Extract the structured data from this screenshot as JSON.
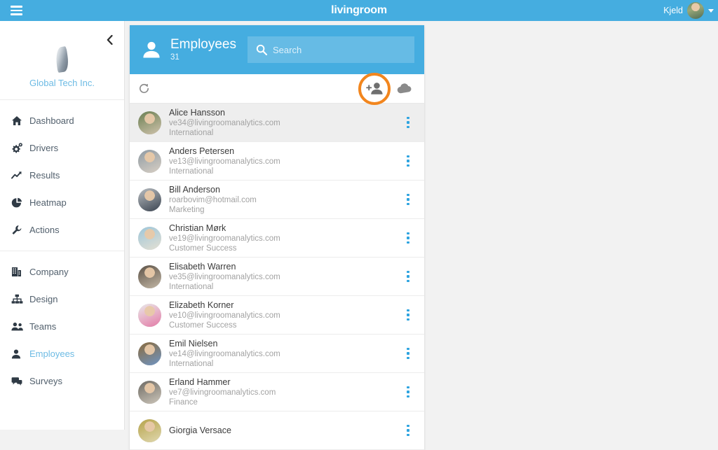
{
  "topbar": {
    "menu_icon": "hamburger-icon",
    "brand": "livingroom",
    "user_name": "Kjeld",
    "caret_icon": "chevron-down-icon",
    "brand_color": "#45ade0"
  },
  "sidebar": {
    "collapse_icon": "chevron-left-icon",
    "org_name": "Global Tech Inc.",
    "org_logo_icon": "feather-logo-icon",
    "active_item": "Employees",
    "accent_color": "#6dbbe4",
    "groups": [
      {
        "items": [
          {
            "label": "Dashboard",
            "icon": "home-icon",
            "active": false
          },
          {
            "label": "Drivers",
            "icon": "gears-icon",
            "active": false
          },
          {
            "label": "Results",
            "icon": "trending-up-icon",
            "active": false
          },
          {
            "label": "Heatmap",
            "icon": "pie-chart-icon",
            "active": false
          },
          {
            "label": "Actions",
            "icon": "wrench-icon",
            "active": false
          }
        ]
      },
      {
        "items": [
          {
            "label": "Company",
            "icon": "building-icon",
            "active": false
          },
          {
            "label": "Design",
            "icon": "sitemap-icon",
            "active": false
          },
          {
            "label": "Teams",
            "icon": "people-icon",
            "active": false
          },
          {
            "label": "Employees",
            "icon": "person-icon",
            "active": true
          },
          {
            "label": "Surveys",
            "icon": "comments-icon",
            "active": false
          }
        ]
      }
    ]
  },
  "panel": {
    "header": {
      "icon": "person-icon",
      "title": "Employees",
      "count": "31"
    },
    "search": {
      "icon": "search-icon",
      "placeholder": "Search",
      "value": ""
    },
    "toolbar": {
      "refresh_icon": "refresh-icon",
      "add_person_icon": "add-person-icon",
      "upload_icon": "cloud-upload-icon",
      "highlight": {
        "target": "add-person-icon",
        "color": "#f2861e",
        "shape": "ring"
      }
    },
    "row_menu_icon": "more-vertical-icon",
    "employees": [
      {
        "name": "Alice Hansson",
        "email": "ve34@livingroomanalytics.com",
        "department": "International",
        "hovered": true,
        "avatar_a": "#6a7f52",
        "avatar_b": "#cfc2ab"
      },
      {
        "name": "Anders Petersen",
        "email": "ve13@livingroomanalytics.com",
        "department": "International",
        "hovered": false,
        "avatar_a": "#8e9aa3",
        "avatar_b": "#d8cfc4"
      },
      {
        "name": "Bill Anderson",
        "email": "roarbovim@hotmail.com",
        "department": "Marketing",
        "hovered": false,
        "avatar_a": "#b9bec2",
        "avatar_b": "#3b4450"
      },
      {
        "name": "Christian Mørk",
        "email": "ve19@livingroomanalytics.com",
        "department": "Customer Success",
        "hovered": false,
        "avatar_a": "#9dc6da",
        "avatar_b": "#e4e0d3"
      },
      {
        "name": "Elisabeth Warren",
        "email": "ve35@livingroomanalytics.com",
        "department": "International",
        "hovered": false,
        "avatar_a": "#5c5247",
        "avatar_b": "#c3b7a5"
      },
      {
        "name": "Elizabeth Korner",
        "email": "ve10@livingroomanalytics.com",
        "department": "Customer Success",
        "hovered": false,
        "avatar_a": "#eaeaea",
        "avatar_b": "#e37aa6"
      },
      {
        "name": "Emil Nielsen",
        "email": "ve14@livingroomanalytics.com",
        "department": "International",
        "hovered": false,
        "avatar_a": "#8a6a3c",
        "avatar_b": "#6f95c4"
      },
      {
        "name": "Erland Hammer",
        "email": "ve7@livingroomanalytics.com",
        "department": "Finance",
        "hovered": false,
        "avatar_a": "#6d6a63",
        "avatar_b": "#cdc6ba"
      },
      {
        "name": "Giorgia Versace",
        "email": "",
        "department": "",
        "hovered": false,
        "avatar_a": "#b6a34a",
        "avatar_b": "#e0d8b0"
      }
    ]
  }
}
